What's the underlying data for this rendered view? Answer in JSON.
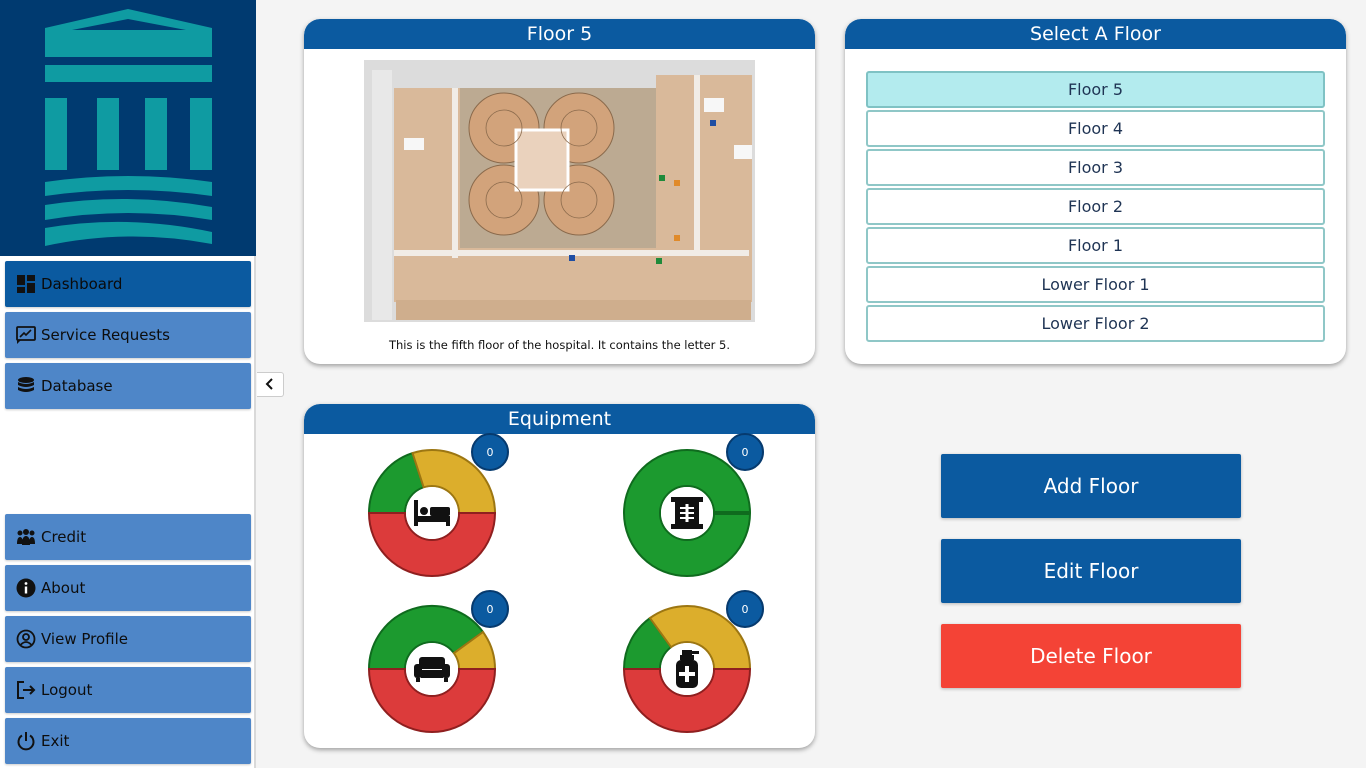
{
  "sidebar": {
    "nav_top": [
      {
        "label": "Dashboard",
        "icon": "dashboard-icon",
        "active": true
      },
      {
        "label": "Service Requests",
        "icon": "service-request-icon",
        "active": false
      },
      {
        "label": "Database",
        "icon": "database-icon",
        "active": false
      }
    ],
    "nav_bottom": [
      {
        "label": "Credit",
        "icon": "people-icon"
      },
      {
        "label": "About",
        "icon": "info-icon"
      },
      {
        "label": "View Profile",
        "icon": "profile-icon"
      },
      {
        "label": "Logout",
        "icon": "logout-icon"
      },
      {
        "label": "Exit",
        "icon": "power-icon"
      }
    ]
  },
  "floor_panel": {
    "title": "Floor 5",
    "caption": "This is the fifth floor of the hospital. It contains the letter 5."
  },
  "select_panel": {
    "title": "Select A Floor",
    "floors": [
      "Floor 5",
      "Floor 4",
      "Floor 3",
      "Floor 2",
      "Floor 1",
      "Lower Floor 1",
      "Lower Floor 2"
    ],
    "selected": "Floor 5"
  },
  "equipment_panel": {
    "title": "Equipment",
    "items": [
      {
        "icon": "bed-icon",
        "count": "0",
        "segments": {
          "green": 0.2,
          "yellow": 0.3,
          "red": 0.5
        }
      },
      {
        "icon": "xray-icon",
        "count": "0",
        "segments": {
          "green": 1.0,
          "yellow": 0,
          "red": 0
        }
      },
      {
        "icon": "recliner-icon",
        "count": "0",
        "segments": {
          "green": 0.4,
          "yellow": 0.1,
          "red": 0.5
        }
      },
      {
        "icon": "infusion-pump-icon",
        "count": "0",
        "segments": {
          "green": 0.15,
          "yellow": 0.35,
          "red": 0.5
        }
      }
    ]
  },
  "actions": {
    "add": "Add Floor",
    "edit": "Edit Floor",
    "delete": "Delete Floor"
  },
  "colors": {
    "brand_dark": "#003a70",
    "logo_teal": "#0f9ba2",
    "header_blue": "#0b5aa0",
    "nav_blue": "#4e86c8",
    "selected_floor": "#b3ebee",
    "delete_red": "#f44336",
    "gauge_green": "#1c9a2f",
    "gauge_yellow": "#dcae2c",
    "gauge_red": "#dc3b3b"
  }
}
